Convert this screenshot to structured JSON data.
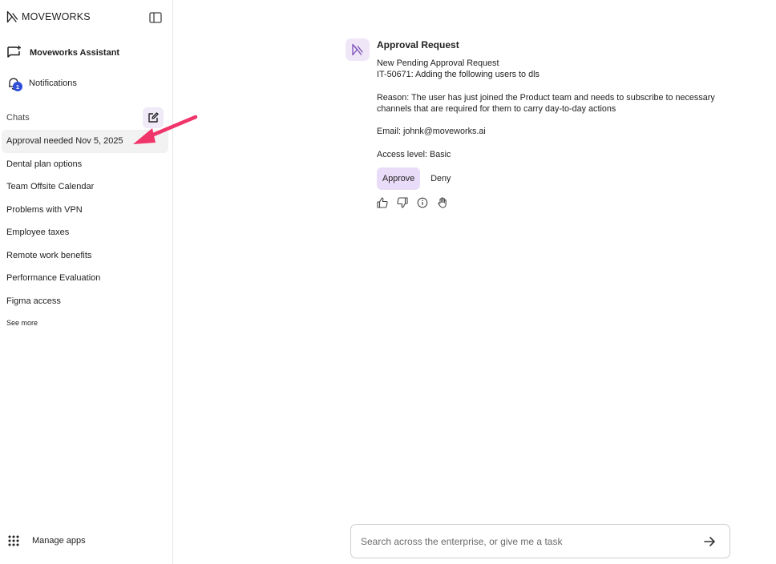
{
  "brand": {
    "name": "MOVEWORKS"
  },
  "sidebar": {
    "assistant_label": "Moveworks Assistant",
    "notifications_label": "Notifications",
    "notifications_count": "1",
    "chats_header": "Chats",
    "chats": [
      {
        "label": "Approval needed Nov 5, 2025"
      },
      {
        "label": "Dental plan options"
      },
      {
        "label": "Team Offsite Calendar"
      },
      {
        "label": "Problems with VPN"
      },
      {
        "label": "Employee taxes"
      },
      {
        "label": "Remote work benefits"
      },
      {
        "label": "Performance Evaluation"
      },
      {
        "label": "Figma access"
      }
    ],
    "see_more": "See more",
    "manage_apps": "Manage apps"
  },
  "message": {
    "title": "Approval Request",
    "line1": "New Pending Approval Request",
    "line2": "IT-50671: Adding the following users to dls",
    "reason": "Reason: The user has just joined the Product team and needs to subscribe to necessary channels that are required for them to carry day-to-day actions",
    "email": "Email: johnk@moveworks.ai",
    "access": "Access level: Basic",
    "approve_label": "Approve",
    "deny_label": "Deny"
  },
  "composer": {
    "placeholder": "Search across the enterprise, or give me a task"
  },
  "colors": {
    "accent": "#e9dcf8",
    "badge": "#2f4fd8",
    "annotation": "#f0356b"
  }
}
